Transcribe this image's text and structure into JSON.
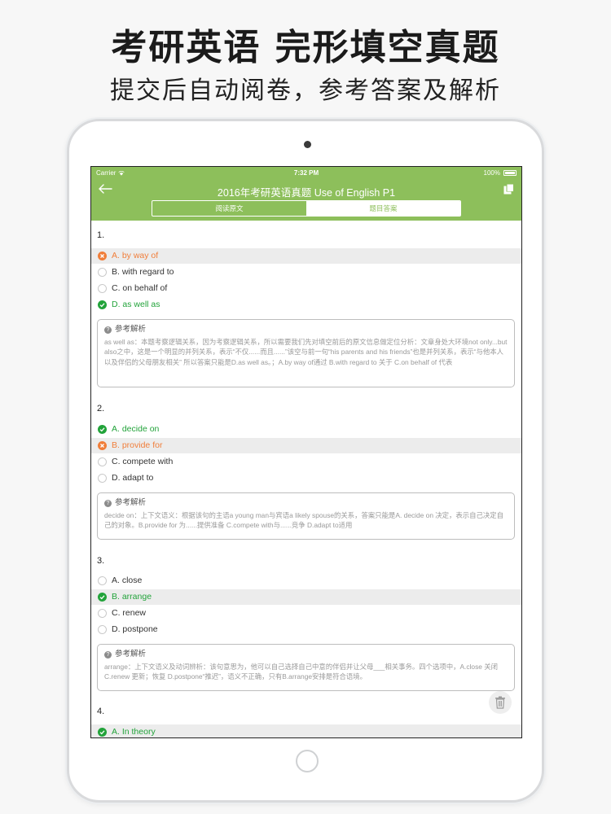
{
  "promo": {
    "title": "考研英语  完形填空真题",
    "subtitle": "提交后自动阅卷，参考答案及解析"
  },
  "statusbar": {
    "carrier": "Carrier",
    "time": "7:32 PM",
    "battery": "100%"
  },
  "navbar": {
    "title": "2016年考研英语真题 Use of English P1",
    "back_icon": "back-arrow-icon",
    "copy_icon": "copy-icon"
  },
  "segment": {
    "tab1": "阅读原文",
    "tab2": "题目答案",
    "selected": "题目答案"
  },
  "colors": {
    "accent": "#8dbf5b",
    "correct": "#22a33a",
    "wrong": "#f07e3a"
  },
  "analysis_label": "参考解析",
  "questions": [
    {
      "number": "1.",
      "options": [
        {
          "label": "A. by way of",
          "state": "wrong",
          "highlight": true
        },
        {
          "label": "B. with regard to",
          "state": "none",
          "highlight": false
        },
        {
          "label": "C. on behalf of",
          "state": "none",
          "highlight": false
        },
        {
          "label": "D. as well as",
          "state": "correct",
          "highlight": false
        }
      ],
      "analysis": "as well as：本题考察逻辑关系，因为考察逻辑关系，所以需要我们先对填空前后的原文信息做定位分析：文章身处大环境not only...but also之中，这是一个明显的并列关系，表示“不仅......而且......”该空与前一句“his parents and his friends”也是并列关系，表示“与他本人以及伴侣的父母朋友相关” 所以答案只能是D.as well as。；A.by way of通过 B.with regard to 关于 C.on behalf of 代表"
    },
    {
      "number": "2.",
      "options": [
        {
          "label": "A. decide on",
          "state": "correct",
          "highlight": false
        },
        {
          "label": "B. provide for",
          "state": "wrong",
          "highlight": true
        },
        {
          "label": "C. compete with",
          "state": "none",
          "highlight": false
        },
        {
          "label": "D. adapt to",
          "state": "none",
          "highlight": false
        }
      ],
      "analysis": "decide on：上下文语义：根据该句的主语a young man与宾语a likely spouse的关系，答案只能是A. decide on 决定，表示自己决定自己的对象。B.provide for 为......提供准备 C.compete with与......竞争 D.adapt to适用"
    },
    {
      "number": "3.",
      "options": [
        {
          "label": "A. close",
          "state": "none",
          "highlight": false
        },
        {
          "label": "B. arrange",
          "state": "correct",
          "highlight": true
        },
        {
          "label": "C. renew",
          "state": "none",
          "highlight": false
        },
        {
          "label": "D. postpone",
          "state": "none",
          "highlight": false
        }
      ],
      "analysis": "arrange：上下文语义及动词辨析：该句意思为，他可以自己选择自己中意的伴侣并让父母___相关事务。四个选项中，A.close 关闭 C.renew 更新；恢复 D.postpone“推迟”，语义不正确，只有B.arrange安排是符合语境。"
    },
    {
      "number": "4.",
      "options": [
        {
          "label": "A. In theory",
          "state": "correct",
          "highlight": false
        }
      ]
    }
  ],
  "trash_icon": "trash-icon"
}
